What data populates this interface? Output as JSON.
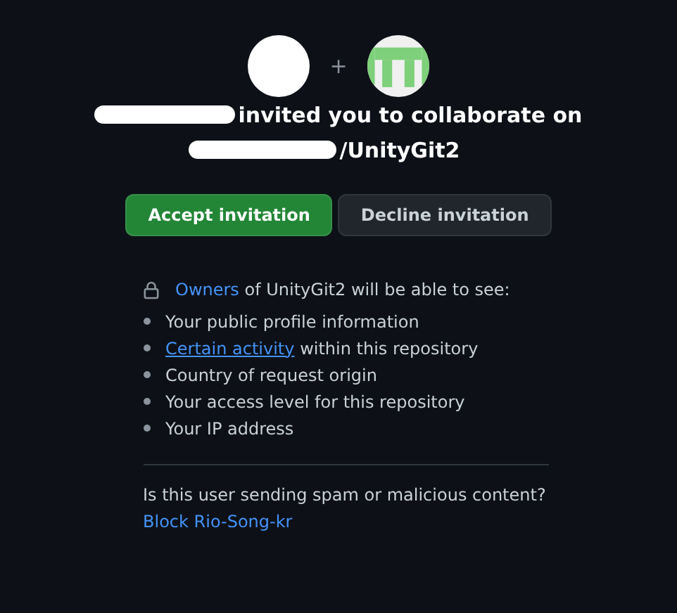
{
  "header": {
    "separator": "+",
    "invite_text": "invited you to collaborate on",
    "repository": "/UnityGit2"
  },
  "buttons": [
    {
      "label": "Accept invitation",
      "kind": "primary"
    },
    {
      "label": "Decline invitation",
      "kind": "secondary"
    }
  ],
  "permissions": {
    "owners_link": "Owners",
    "intro": "of UnityGit2 will be able to see:",
    "items": [
      {
        "text": "Your public profile information"
      },
      {
        "link": "Certain activity",
        "text": "within this repository"
      },
      {
        "text": "Country of request origin"
      },
      {
        "text": "Your access level for this repository"
      },
      {
        "text": "Your IP address"
      }
    ]
  },
  "report": {
    "question": "Is this user sending spam or malicious content?",
    "block_link": "Block Rio-Song-kr"
  }
}
